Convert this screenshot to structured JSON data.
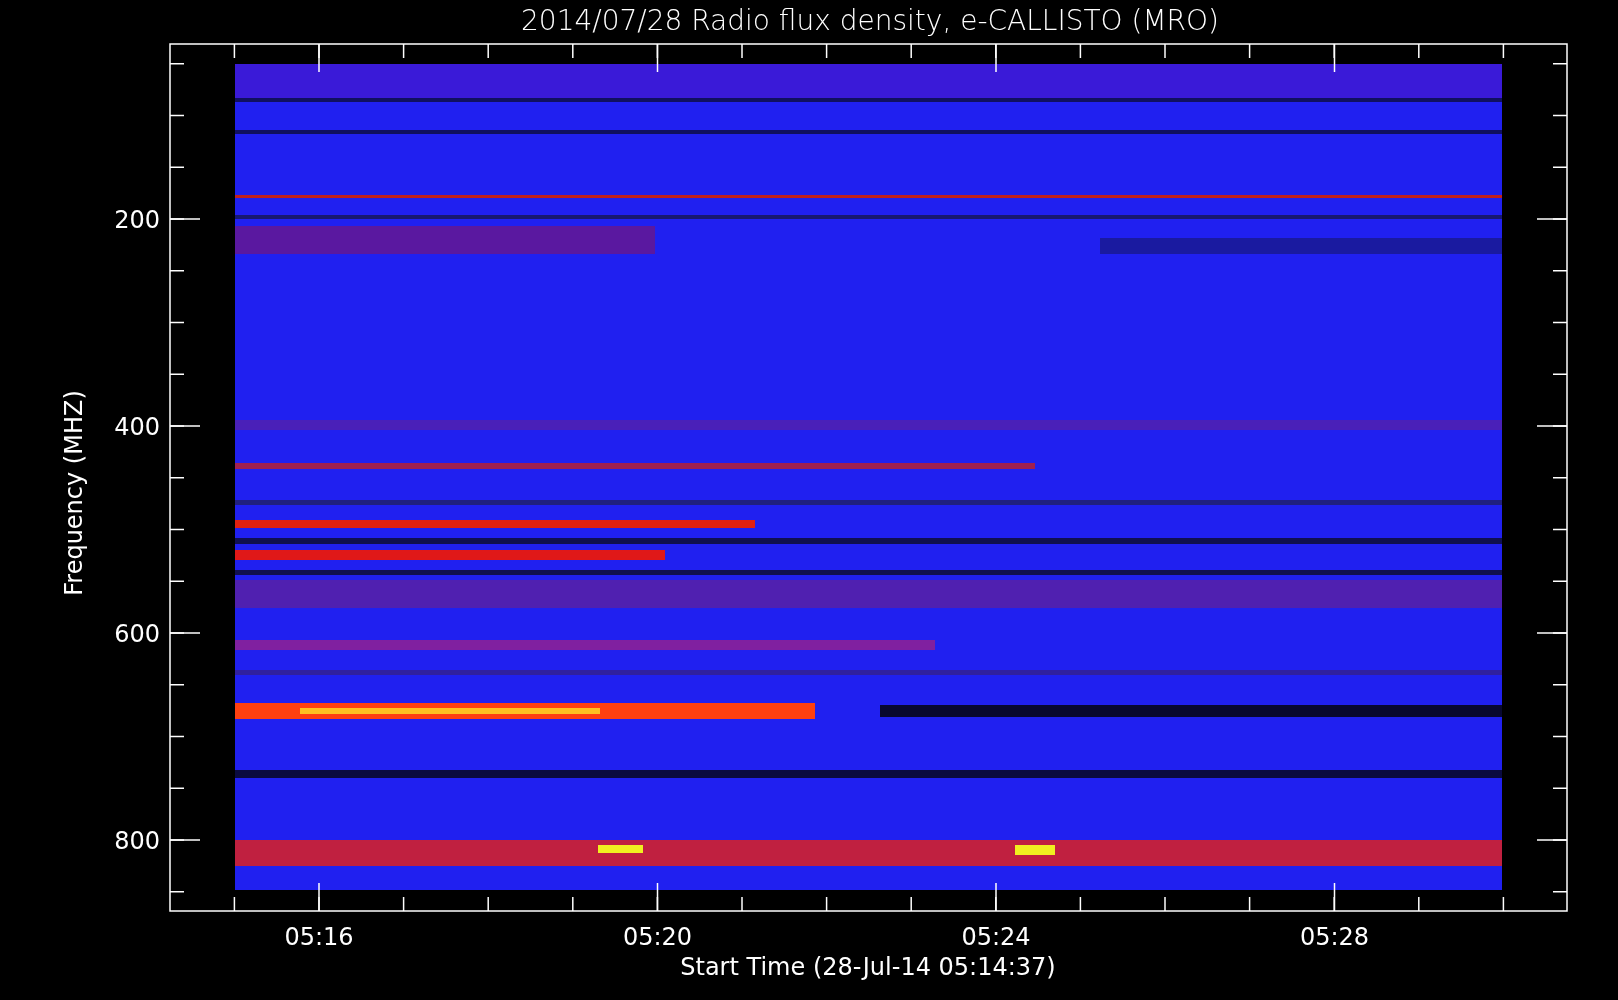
{
  "title": "2014/07/28  Radio flux density, e-CALLISTO (MRO)",
  "y_axis": {
    "label": "Frequency (MHZ)",
    "ticks": [
      "200",
      "400",
      "600",
      "800"
    ]
  },
  "x_axis": {
    "label": "Start Time (28-Jul-14 05:14:37)",
    "ticks": [
      "05:16",
      "05:20",
      "05:24",
      "05:28"
    ]
  }
}
